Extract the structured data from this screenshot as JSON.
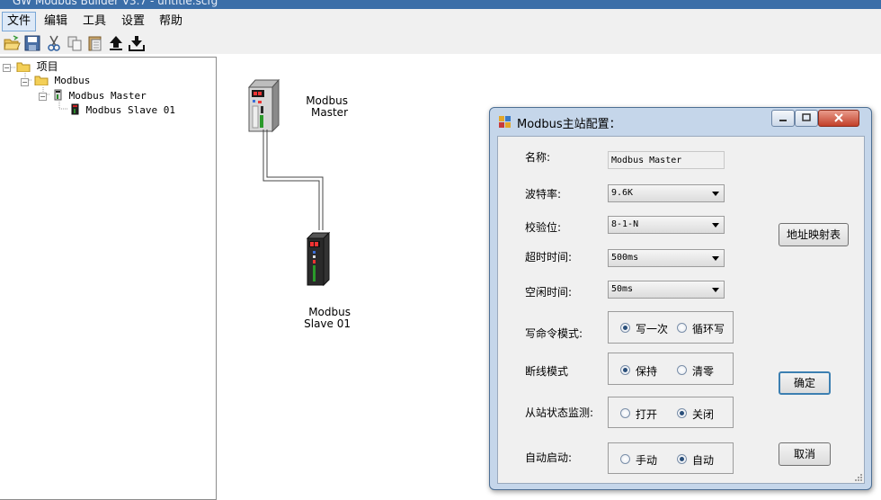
{
  "window": {
    "title": "GW Modbus Builder V3.7 - untitle.scfg"
  },
  "menu": {
    "items": [
      "文件",
      "编辑",
      "工具",
      "设置",
      "帮助"
    ]
  },
  "toolbar": {
    "icons": [
      "open-folder-icon",
      "save-icon",
      "cut-icon",
      "copy-icon",
      "paste-icon",
      "upload-icon",
      "download-icon"
    ]
  },
  "tree": {
    "root": "项目",
    "modbus": "Modbus",
    "master": "Modbus Master",
    "slave": "Modbus Slave  01"
  },
  "canvas": {
    "master_line1": "Modbus",
    "master_line2": "Master",
    "slave_line1": "Modbus",
    "slave_line2": "Slave  01"
  },
  "dialog": {
    "title": "Modbus主站配置：",
    "name_label": "名称:",
    "name_value": "Modbus Master",
    "baud_label": "波特率:",
    "baud_value": "9.6K",
    "parity_label": "校验位:",
    "parity_value": "8-1-N",
    "timeout_label": "超时时间:",
    "timeout_value": "500ms",
    "idle_label": "空闲时间:",
    "idle_value": "50ms",
    "write_mode_label": "写命令模式:",
    "write_once": "写一次",
    "write_cycle": "循环写",
    "disconnect_label": "断线模式",
    "keep": "保持",
    "clear": "清零",
    "monitor_label": "从站状态监测:",
    "open": "打开",
    "close": "关闭",
    "autostart_label": "自动启动:",
    "manual": "手动",
    "auto": "自动",
    "map_button": "地址映射表",
    "ok_button": "确定",
    "cancel_button": "取消"
  },
  "colors": {
    "titlebar": "#3b6ea8",
    "dialog_frame": "#c5d6ea",
    "accent": "#3c7fb1"
  }
}
